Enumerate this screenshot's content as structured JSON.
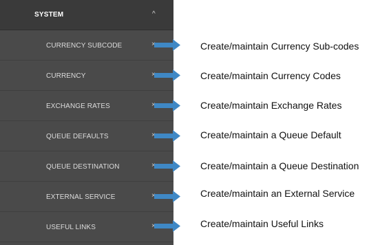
{
  "sidebar": {
    "system_label": "SYSTEM",
    "collapse_icon": "chevron-up-icon",
    "items": [
      {
        "label": "CURRENCY SUBCODE",
        "description": "Create/maintain Currency Sub-codes"
      },
      {
        "label": "CURRENCY",
        "description": "Create/maintain Currency Codes"
      },
      {
        "label": "EXCHANGE RATES",
        "description": "Create/maintain Exchange Rates"
      },
      {
        "label": "QUEUE DEFAULTS",
        "description": "Create/maintain a Queue Default"
      },
      {
        "label": "QUEUE DESTINATION",
        "description": "Create/maintain a Queue Destination"
      },
      {
        "label": "EXTERNAL SERVICE",
        "description": "Create/maintain an External Service"
      },
      {
        "label": "USEFUL LINKS",
        "description": "Create/maintain Useful Links"
      }
    ]
  },
  "colors": {
    "sidebar_bg": "#4a4a4a",
    "header_bg": "#3a3a3a",
    "arrow": "#3f88c5"
  }
}
